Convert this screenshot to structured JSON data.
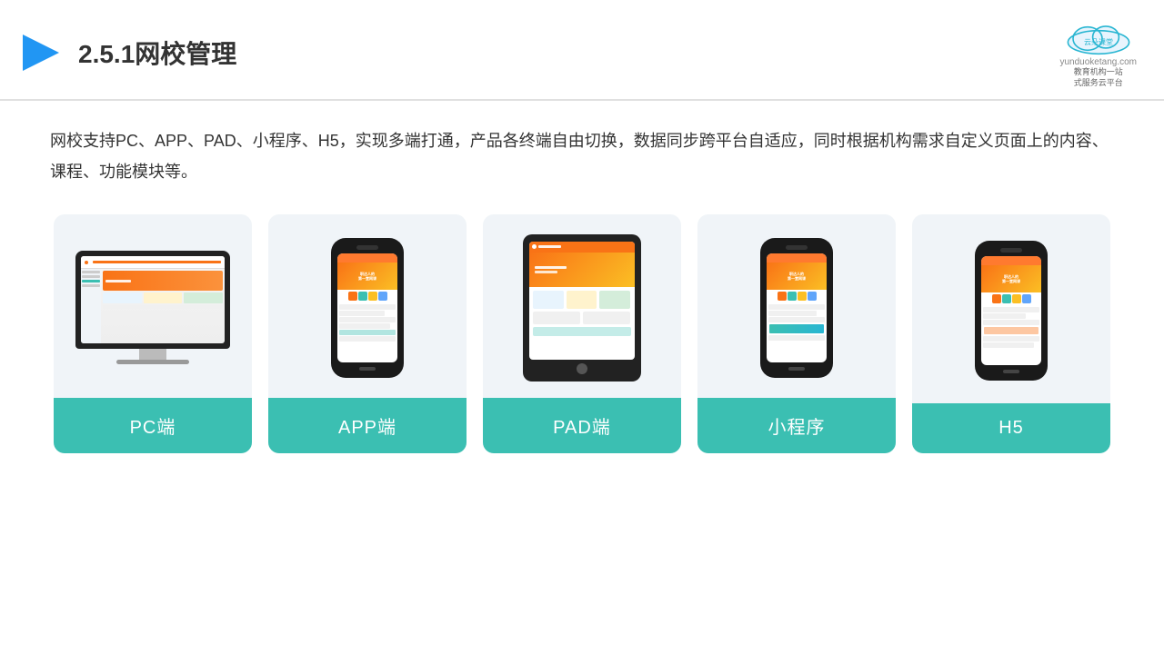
{
  "header": {
    "title": "2.5.1网校管理",
    "logo_name": "云朵课堂",
    "logo_sub1": "教育机构一站",
    "logo_sub2": "式服务云平台",
    "logo_url": "yunduoketang.com"
  },
  "description": "网校支持PC、APP、PAD、小程序、H5，实现多端打通，产品各终端自由切换，数据同步跨平台自适应，同时根据机构需求自定义页面上的内容、课程、功能模块等。",
  "cards": [
    {
      "id": "pc",
      "label": "PC端"
    },
    {
      "id": "app",
      "label": "APP端"
    },
    {
      "id": "pad",
      "label": "PAD端"
    },
    {
      "id": "mini",
      "label": "小程序"
    },
    {
      "id": "h5",
      "label": "H5"
    }
  ],
  "accent_color": "#3bbfb2"
}
